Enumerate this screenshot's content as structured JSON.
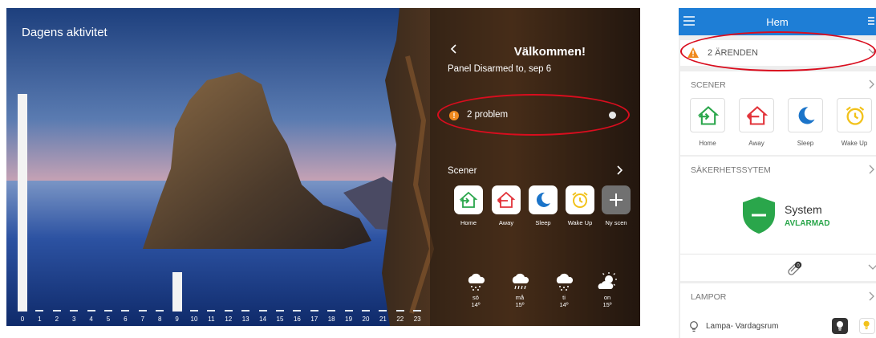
{
  "left_panel": {
    "title": "Dagens aktivitet",
    "activity": [
      22,
      0,
      0,
      0,
      0,
      0,
      0,
      0,
      0,
      4,
      0,
      0,
      0,
      0,
      0,
      0,
      0,
      0,
      0,
      0,
      0,
      0,
      0,
      0
    ],
    "hours": [
      "0",
      "1",
      "2",
      "3",
      "4",
      "5",
      "6",
      "7",
      "8",
      "9",
      "10",
      "11",
      "12",
      "13",
      "14",
      "15",
      "16",
      "17",
      "18",
      "19",
      "20",
      "21",
      "22",
      "23"
    ],
    "axis_icons": [
      "sunrise-icon",
      "moon-icon"
    ],
    "welcome_title": "Välkommen!",
    "panel_status": "Panel Disarmed to, sep 6",
    "problem_badge": "!",
    "problem_label": "2 problem",
    "scener_label": "Scener",
    "scenes": [
      {
        "label": "Home",
        "icon": "home-enter-icon",
        "color": "#2aa64b"
      },
      {
        "label": "Away",
        "icon": "home-leave-icon",
        "color": "#e2333a"
      },
      {
        "label": "Sleep",
        "icon": "moon-icon",
        "color": "#1b74c9"
      },
      {
        "label": "Wake Up",
        "icon": "alarm-clock-icon",
        "color": "#f2c21b"
      },
      {
        "label": "Ny scen",
        "icon": "plus-icon",
        "color": "#ffffff"
      }
    ],
    "weather": [
      {
        "day": "sö",
        "temp": "14º",
        "icon": "snow-cloud-icon"
      },
      {
        "day": "må",
        "temp": "15º",
        "icon": "rain-cloud-icon"
      },
      {
        "day": "ti",
        "temp": "14º",
        "icon": "snow-cloud-icon"
      },
      {
        "day": "on",
        "temp": "15º",
        "icon": "partly-sunny-icon"
      }
    ]
  },
  "phone": {
    "title": "Hem",
    "issues_label": "2 ÄRENDEN",
    "scener_header": "SCENER",
    "scenes": [
      {
        "label": "Home",
        "icon": "home-enter-icon"
      },
      {
        "label": "Away",
        "icon": "home-leave-icon"
      },
      {
        "label": "Sleep",
        "icon": "moon-icon"
      },
      {
        "label": "Wake Up",
        "icon": "alarm-clock-icon"
      }
    ],
    "security_header": "SÄKERHETSSYTEM",
    "system_name": "System",
    "system_state": "AVLARMAD",
    "attachment_count": "0",
    "lampor_header": "LAMPOR",
    "lamp_name": "Lampa- Vardagsrum"
  },
  "colors": {
    "accent": "#1e7ed6",
    "highlight_ring": "#d90d1e",
    "warning": "#f08a1e",
    "ok": "#2aa64b"
  }
}
